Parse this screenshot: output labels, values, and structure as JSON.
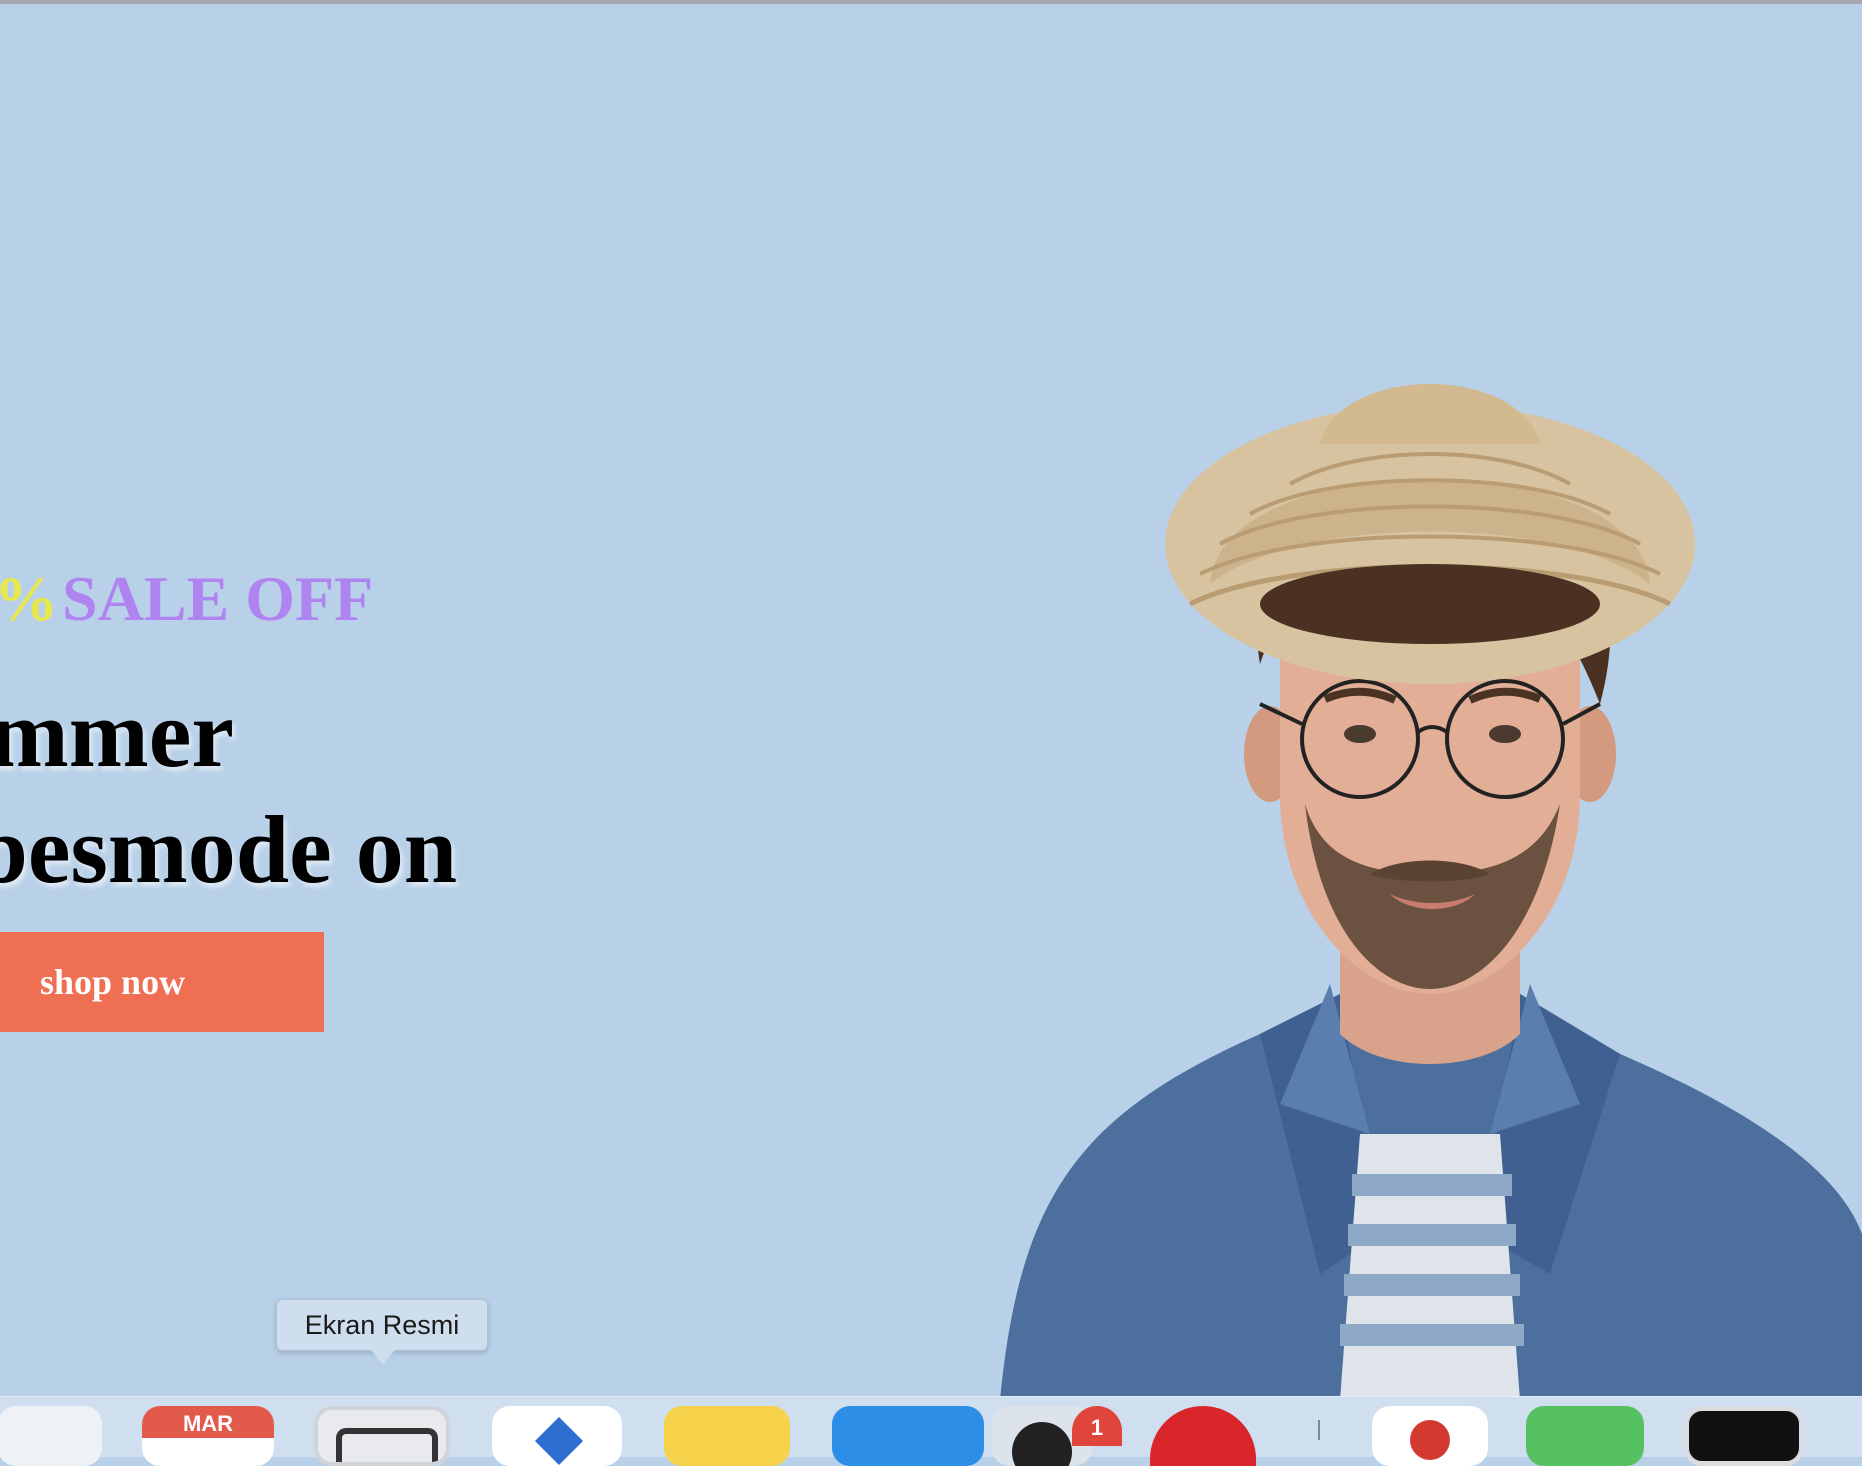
{
  "hero": {
    "sale_percent": "%",
    "sale_text": "SALE OFF",
    "headline_line1": "Summer",
    "headline_line2": "Vibesmode on",
    "cta_label": "shop now",
    "colors": {
      "background": "#b9d1e8",
      "sale_percent": "#e7e84a",
      "sale_text": "#b084f0",
      "cta": "#ee6f52"
    }
  },
  "dock": {
    "tooltip": "Ekran Resmi",
    "calendar_month": "MAR",
    "badge_count": "1",
    "icons": [
      "finder-icon",
      "calendar-icon",
      "screenshot-icon",
      "mail-icon",
      "notes-icon",
      "app-store-icon",
      "messenger-icon",
      "opera-icon",
      "chrome-icon",
      "facetime-icon",
      "terminal-icon"
    ]
  }
}
